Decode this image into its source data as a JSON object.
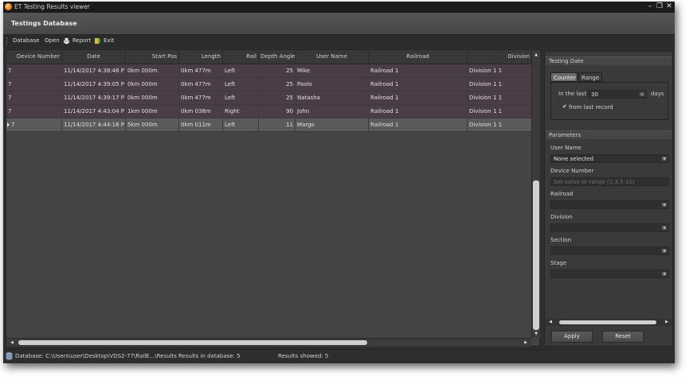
{
  "window": {
    "title": "ET Testing Results viewer",
    "controls": {
      "minimize": "–",
      "restore": "❐",
      "close": "✕"
    }
  },
  "header": {
    "title": "Testings Database"
  },
  "menu": {
    "database": "Database",
    "open": "Open",
    "report": "Report",
    "exit": "Exit"
  },
  "table": {
    "columns": [
      "Device Number",
      "Date",
      "Start Pos",
      "Length",
      "Rail",
      "Depth Angle",
      "User Name",
      "Railroad",
      "Division"
    ],
    "rows": [
      {
        "device": "7",
        "date": "11/14/2017 4:38:46 P",
        "start": "0km 000m",
        "length": "0km 477m",
        "rail": "Left",
        "depth": "25",
        "user": "Mike",
        "railroad": "Railroad 1",
        "division": "Division 1 1"
      },
      {
        "device": "7",
        "date": "11/14/2017 4:39:05 P",
        "start": "0km 000m",
        "length": "0km 477m",
        "rail": "Left",
        "depth": "25",
        "user": "Paolo",
        "railroad": "Railroad 1",
        "division": "Division 1 1"
      },
      {
        "device": "7",
        "date": "11/14/2017 4:39:17 P",
        "start": "0km 000m",
        "length": "0km 477m",
        "rail": "Left",
        "depth": "25",
        "user": "Natasha",
        "railroad": "Railroad 1",
        "division": "Division 1 1"
      },
      {
        "device": "7",
        "date": "11/14/2017 4:43:04 P",
        "start": "1km 000m",
        "length": "0km 038m",
        "rail": "Right",
        "depth": "90",
        "user": "John",
        "railroad": "Railroad 1",
        "division": "Division 1 1"
      },
      {
        "device": "7",
        "date": "11/14/2017 4:44:16 P",
        "start": "5km 000m",
        "length": "0km 011m",
        "rail": "Left",
        "depth": "11",
        "user": "Margo",
        "railroad": "Railroad 1",
        "division": "Division 1 1"
      }
    ]
  },
  "panel": {
    "testing_date": {
      "title": "Testing Date",
      "tabs": [
        "Counter",
        "Range"
      ],
      "in_the_last_label": "In the last",
      "in_the_last_value": "30",
      "days_label": "days",
      "from_last_record_label": "from last record",
      "from_last_record_checked": true
    },
    "parameters": {
      "title": "Parameters",
      "user_name_label": "User Name",
      "user_name_value": "None selected",
      "device_number_label": "Device Number",
      "device_number_placeholder": "Set value or range (1,3,5-10)",
      "railroad_label": "Railroad",
      "railroad_value": "",
      "division_label": "Division",
      "division_value": "",
      "section_label": "Section",
      "section_value": "",
      "stage_label": "Stage",
      "stage_value": ""
    },
    "apply_label": "Apply",
    "reset_label": "Reset"
  },
  "status": {
    "database": "Database: C:\\Users\\user\\Desktop\\VDS2-77\\RailE...\\Results",
    "results_in_db": "Results in database: 5",
    "results_showed": "Results showed: 5"
  },
  "colors": {
    "row_highlight": "#4b3d46",
    "row_selected": "#5a5a5a",
    "tab_active": "#6a6a6a"
  }
}
